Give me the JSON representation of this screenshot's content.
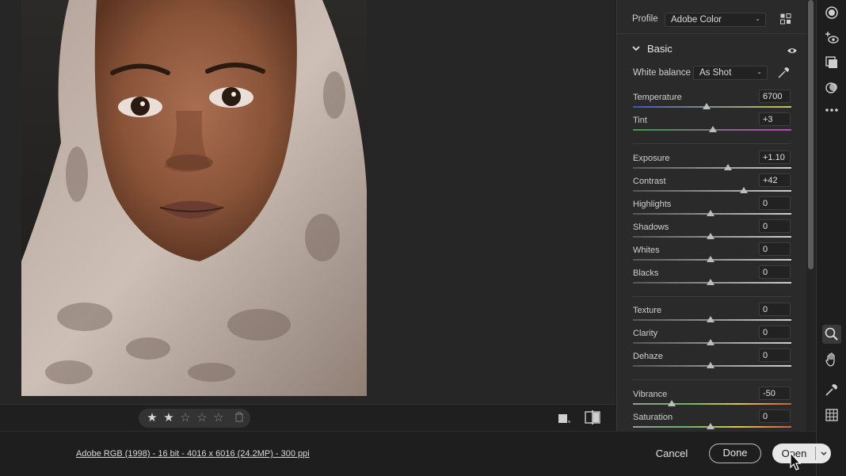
{
  "profile": {
    "label": "Profile",
    "value": "Adobe Color"
  },
  "basic": {
    "title": "Basic",
    "white_balance": {
      "label": "White balance",
      "value": "As Shot"
    },
    "sliders": [
      {
        "name": "Temperature",
        "value": "6700"
      },
      {
        "name": "Tint",
        "value": "+3"
      },
      {
        "name": "Exposure",
        "value": "+1.10"
      },
      {
        "name": "Contrast",
        "value": "+42"
      },
      {
        "name": "Highlights",
        "value": "0"
      },
      {
        "name": "Shadows",
        "value": "0"
      },
      {
        "name": "Whites",
        "value": "0"
      },
      {
        "name": "Blacks",
        "value": "0"
      },
      {
        "name": "Texture",
        "value": "0"
      },
      {
        "name": "Clarity",
        "value": "0"
      },
      {
        "name": "Dehaze",
        "value": "0"
      },
      {
        "name": "Vibrance",
        "value": "-50"
      },
      {
        "name": "Saturation",
        "value": "0"
      }
    ]
  },
  "rating": {
    "filled": 2,
    "total": 5
  },
  "footer": {
    "file_info": "Adobe RGB (1998) - 16 bit - 4016 x 6016 (24.2MP) - 300 ppi",
    "cancel": "Cancel",
    "done": "Done",
    "open": "Open"
  },
  "icons": [
    "edit-icon",
    "crop-heal-icon",
    "masking-icon",
    "red-eye-icon",
    "presets-icon",
    "more-icon",
    "zoom-icon",
    "hand-icon",
    "color-sampler-icon",
    "grid-icon",
    "eyedropper-icon",
    "eye-icon",
    "chevron-down-icon",
    "star-icon",
    "trash-icon",
    "before-after-icon",
    "compare-icon"
  ],
  "colors": {
    "panel": "#2a2a2a",
    "background": "#1e1e1e",
    "open_button": "#e8e8e8"
  }
}
